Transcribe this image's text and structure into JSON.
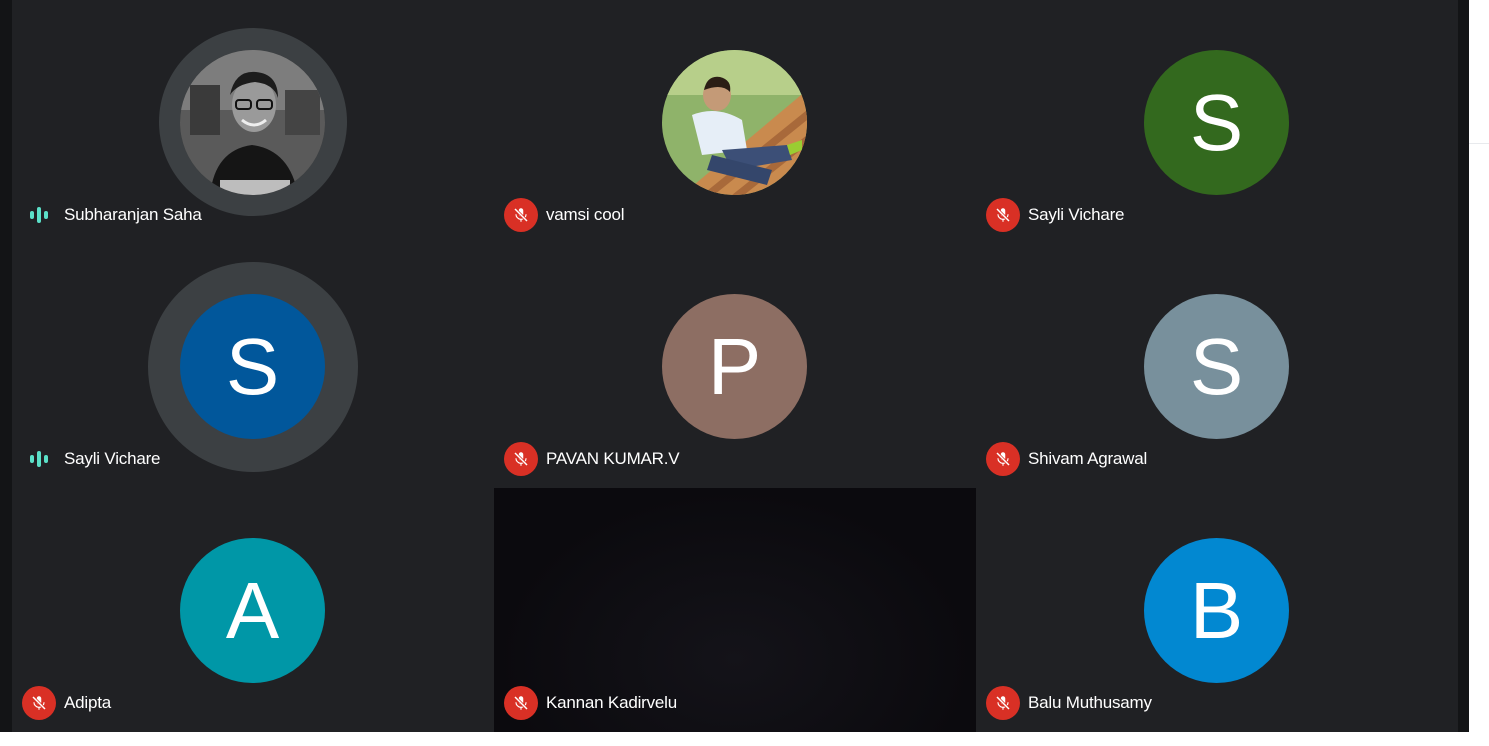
{
  "colors": {
    "stage": "#131416",
    "tile": "#202124",
    "ring": "#3c4043",
    "mic_off": "#d93025",
    "speaking": "#5be0c8"
  },
  "participants": [
    {
      "name": "Subharanjan Saha",
      "status": "speaking",
      "avatar": {
        "type": "photo",
        "icon": "person-photo-bw"
      }
    },
    {
      "name": "vamsi cool",
      "status": "muted",
      "avatar": {
        "type": "photo",
        "icon": "person-photo-color"
      }
    },
    {
      "name": "Sayli Vichare",
      "status": "muted",
      "avatar": {
        "type": "initial",
        "initial": "S",
        "color": "#33691e"
      }
    },
    {
      "name": "Sayli Vichare",
      "status": "speaking",
      "avatar": {
        "type": "initial",
        "initial": "S",
        "color": "#01579b"
      }
    },
    {
      "name": "PAVAN KUMAR.V",
      "status": "muted",
      "avatar": {
        "type": "initial",
        "initial": "P",
        "color": "#8d6e63"
      }
    },
    {
      "name": "Shivam Agrawal",
      "status": "muted",
      "avatar": {
        "type": "initial",
        "initial": "S",
        "color": "#78909c"
      }
    },
    {
      "name": "Adipta",
      "status": "muted",
      "avatar": {
        "type": "initial",
        "initial": "A",
        "color": "#0097a7"
      }
    },
    {
      "name": "Kannan Kadirvelu",
      "status": "muted",
      "avatar": {
        "type": "video"
      }
    },
    {
      "name": "Balu Muthusamy",
      "status": "muted",
      "avatar": {
        "type": "initial",
        "initial": "B",
        "color": "#0288d1"
      }
    }
  ]
}
